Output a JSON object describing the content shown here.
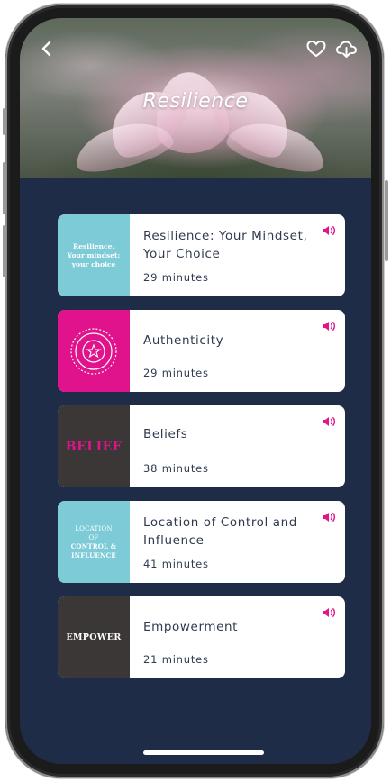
{
  "header": {
    "title": "Resilience"
  },
  "colors": {
    "background": "#1f2c47",
    "accent": "#e1168c",
    "teal": "#7ecbd8",
    "pink": "#e0138c",
    "dark_thumb": "#3c3737"
  },
  "icons": {
    "back": "chevron-left-icon",
    "favorite": "heart-icon",
    "download": "cloud-download-icon",
    "audio": "speaker-icon"
  },
  "sessions": [
    {
      "title": "Resilience: Your Mindset, Your Choice",
      "duration": "29 minutes",
      "thumb_text": [
        "Resilience.",
        "Your mindset:",
        "your choice"
      ]
    },
    {
      "title": "Authenticity",
      "duration": "29 minutes"
    },
    {
      "title": "Beliefs",
      "duration": "38 minutes",
      "thumb_text": "BELIEF"
    },
    {
      "title": "Location of Control and Influence",
      "duration": "41 minutes",
      "thumb_text": [
        "LOCATION",
        "OF",
        "CONTROL &",
        "INFLUENCE"
      ]
    },
    {
      "title": "Empowerment",
      "duration": "21 minutes",
      "thumb_text": "EMPOWER"
    }
  ]
}
